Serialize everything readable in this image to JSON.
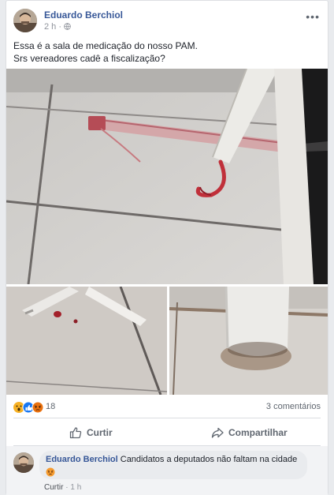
{
  "post": {
    "author": "Eduardo Berchiol",
    "time": "2 h",
    "separator": "·",
    "privacy_icon": "globe-icon",
    "more_icon": "more-icon",
    "text_line1": "Essa é a sala de medicação do nosso PAM.",
    "text_line2": "Srs vereadores cadê a fiscalização?"
  },
  "photos": [
    {
      "name": "photo-floor-blood-stain"
    },
    {
      "name": "photo-floor-blood-drops"
    },
    {
      "name": "photo-chair-leg-rust"
    }
  ],
  "stats": {
    "reactions": [
      "wow-icon",
      "like-icon",
      "angry-icon"
    ],
    "reaction_count": "18",
    "comments": "3 comentários"
  },
  "actions": {
    "like_label": "Curtir",
    "share_label": "Compartilhar"
  },
  "comment": {
    "author": "Eduardo Berchiol",
    "text": "Candidatos a deputados não faltam na cidade",
    "emoji": "angry-emoji",
    "like_label": "Curtir",
    "separator": "·",
    "time": "1 h"
  },
  "colors": {
    "link": "#385898",
    "muted": "#90949c",
    "background": "#e9ebee",
    "blood": "#c0303a"
  }
}
